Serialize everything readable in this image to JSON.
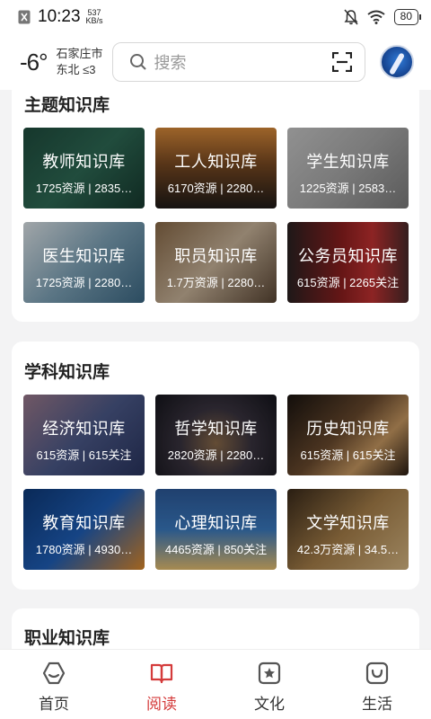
{
  "status": {
    "time": "10:23",
    "speed_value": "537",
    "speed_unit": "KB/s",
    "battery": "80"
  },
  "header": {
    "temperature": "-6°",
    "city": "石家庄市",
    "wind": "东北 ≤3",
    "search_placeholder": "搜索"
  },
  "sections": [
    {
      "title": "主题知识库",
      "cards": [
        {
          "name": "教师知识库",
          "stats": "1725资源 | 2835…"
        },
        {
          "name": "工人知识库",
          "stats": "6170资源 | 2280…"
        },
        {
          "name": "学生知识库",
          "stats": "1225资源 | 2583…"
        },
        {
          "name": "医生知识库",
          "stats": "1725资源 | 2280…"
        },
        {
          "name": "职员知识库",
          "stats": "1.7万资源 | 2280…"
        },
        {
          "name": "公务员知识库",
          "stats": "615资源 | 2265关注"
        }
      ]
    },
    {
      "title": "学科知识库",
      "cards": [
        {
          "name": "经济知识库",
          "stats": "615资源 | 615关注"
        },
        {
          "name": "哲学知识库",
          "stats": "2820资源 | 2280…"
        },
        {
          "name": "历史知识库",
          "stats": "615资源 | 615关注"
        },
        {
          "name": "教育知识库",
          "stats": "1780资源 | 4930…"
        },
        {
          "name": "心理知识库",
          "stats": "4465资源 | 850关注"
        },
        {
          "name": "文学知识库",
          "stats": "42.3万资源 | 34.5…"
        }
      ]
    },
    {
      "title": "职业知识库",
      "cards": []
    }
  ],
  "tabs": [
    {
      "label": "首页",
      "icon": "home-icon"
    },
    {
      "label": "阅读",
      "icon": "book-icon"
    },
    {
      "label": "文化",
      "icon": "star-icon"
    },
    {
      "label": "生活",
      "icon": "bag-icon"
    }
  ],
  "colors": {
    "accent": "#d43b3b",
    "background": "#f3f3f4"
  }
}
